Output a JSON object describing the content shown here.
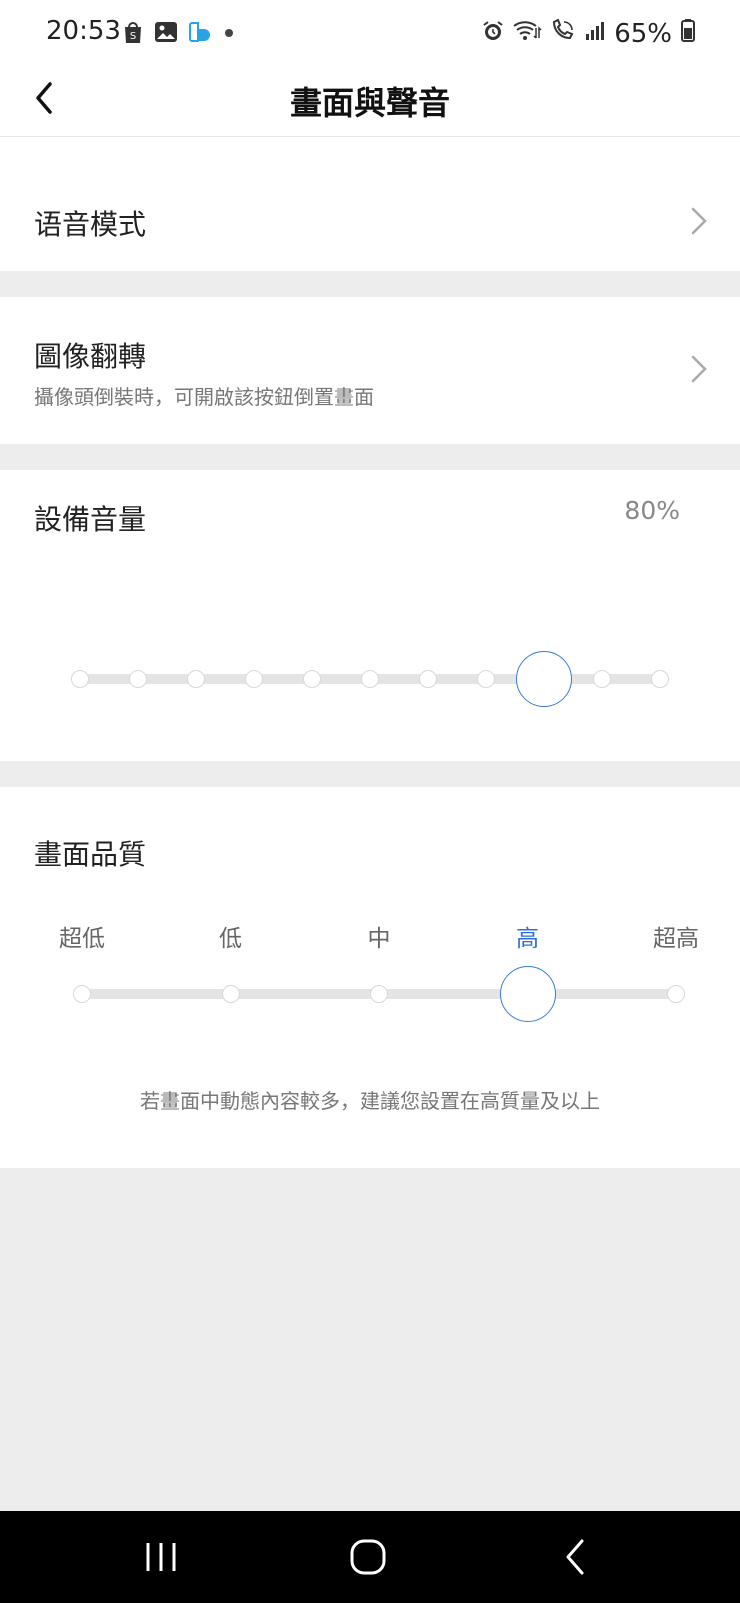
{
  "status": {
    "time": "20:53",
    "battery": "65%",
    "left_icons": [
      "shopee-icon",
      "gallery-icon",
      "app-notification-icon",
      "dot-icon"
    ],
    "right_icons": [
      "alarm-icon",
      "wifi-icon",
      "wifi-call-icon",
      "signal-icon",
      "battery-icon"
    ]
  },
  "header": {
    "title": "畫面與聲音",
    "back_icon": "chevron-left-icon"
  },
  "voice_mode": {
    "label": "语音模式"
  },
  "image_flip": {
    "label": "圖像翻轉",
    "sublabel": "攝像頭倒裝時，可開啟該按鈕倒置畫面"
  },
  "device_volume": {
    "label": "設備音量",
    "value_text": "80%",
    "level": 0.8,
    "steps": 10
  },
  "picture_quality": {
    "label": "畫面品質",
    "options": [
      "超低",
      "低",
      "中",
      "高",
      "超高"
    ],
    "selected_index": 3,
    "hint": "若畫面中動態內容較多，建議您設置在高質量及以上"
  },
  "colors": {
    "accent": "#3b7bd4",
    "track": "#e4e4e4",
    "background": "#ededed"
  },
  "navbar": {
    "icons": [
      "recent-apps-icon",
      "home-icon",
      "back-icon"
    ]
  }
}
